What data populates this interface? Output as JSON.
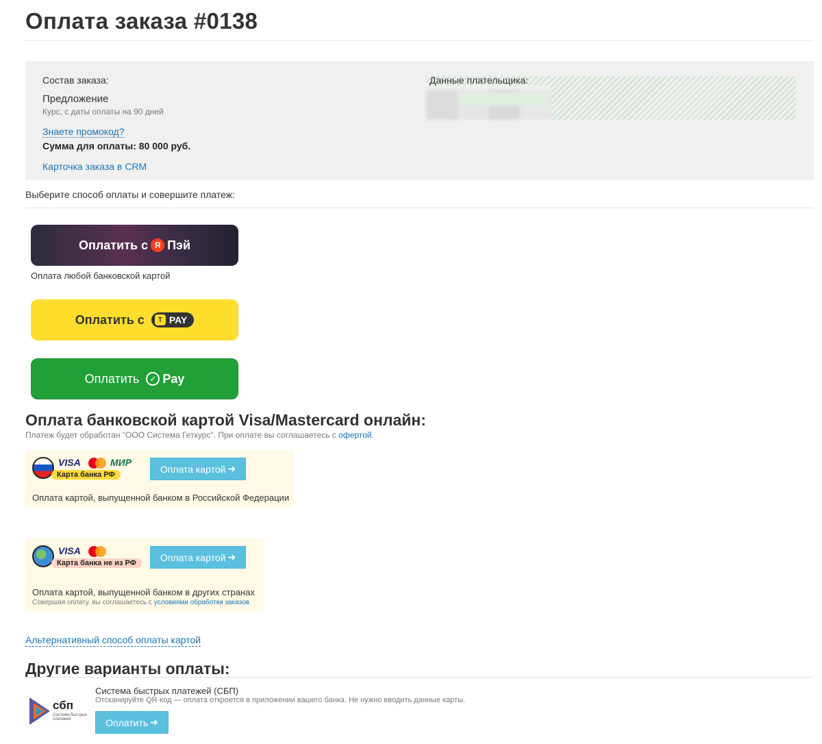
{
  "page": {
    "title": "Оплата заказа #0138"
  },
  "order": {
    "composition_label": "Состав заказа:",
    "offer_name": "Предложение",
    "offer_desc": "Курс, с даты оплаты на 90 дней",
    "promo_link": "Знаете промокод?",
    "sum_text": "Сумма для оплаты: 80 000 руб.",
    "crm_link": "Карточка заказа в CRM",
    "payer_label": "Данные плательщика:"
  },
  "payment": {
    "choose_label": "Выберите способ оплаты и совершите платеж:",
    "yapay": {
      "prefix": "Оплатить с",
      "logo_letter": "Я",
      "brand": "Пэй",
      "note": "Оплата любой банковской картой"
    },
    "tpay": {
      "prefix": "Оплатить с",
      "logo_letter": "T",
      "brand": "PAY"
    },
    "sberpay": {
      "prefix": "Оплатить",
      "brand": "Pay"
    }
  },
  "card_section": {
    "heading": "Оплата банковской картой Visa/Mastercard онлайн:",
    "subtitle_prefix": "Платеж будет обработан \"ООО Система Геткурс\". При оплате вы соглашаетесь с",
    "subtitle_link": "офертой",
    "subtitle_suffix": ".",
    "ru_card": {
      "visa": "VISA",
      "mir": "МИР",
      "pill": "Карта банка РФ",
      "button": "Оплата картой",
      "desc": "Оплата картой, выпущенной банком в Российской Федерации"
    },
    "foreign_card": {
      "visa": "VISA",
      "pill": "Карта банка не из РФ",
      "button": "Оплата картой",
      "desc": "Оплата картой, выпущенной банком в других странах",
      "terms_prefix": "Совершая оплату, вы соглашаетесь с",
      "terms_link": "условиями обработки заказов"
    },
    "alt_link": "Альтернативный способ оплаты картой"
  },
  "other": {
    "heading": "Другие варианты оплаты:",
    "sbp": {
      "logo_text": "сбп",
      "logo_small": "Система быстрых платежей",
      "title": "Система быстрых платежей (СБП)",
      "desc": "Отсканируйте QR-код — оплата откроется в приложении вашего банка. Не нужно вводить данные карты.",
      "button": "Оплатить"
    }
  },
  "icons": {
    "arrow": "arrow-right-icon",
    "check": "check-circle-icon"
  },
  "colors": {
    "link": "#1a73b8",
    "card_button": "#5bc0de",
    "tpay_yellow": "#ffdd2d",
    "sber_green": "#21a038",
    "order_box_bg": "#f0f0f0",
    "card_box_bg": "#fff9e6"
  }
}
